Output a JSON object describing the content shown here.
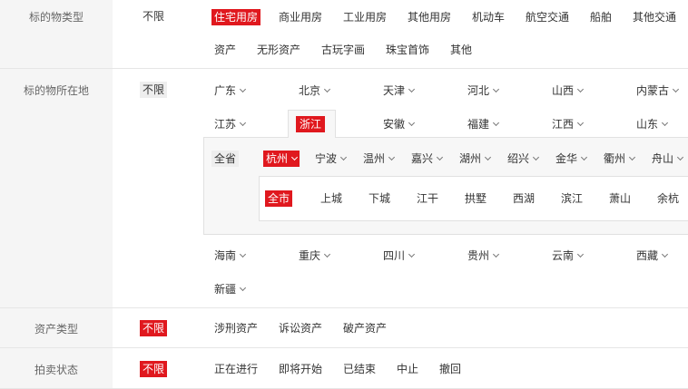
{
  "asset_type_row": {
    "label": "标的物类型",
    "no_limit": "不限",
    "items": [
      "住宅用房",
      "商业用房",
      "工业用房",
      "其他用房",
      "机动车",
      "航空交通",
      "船舶",
      "其他交通",
      "资产",
      "无形资产",
      "古玩字画",
      "珠宝首饰",
      "其他"
    ],
    "selected": "住宅用房"
  },
  "location_row": {
    "label": "标的物所在地",
    "no_limit": "不限",
    "provinces_top": [
      "广东",
      "北京",
      "天津",
      "河北",
      "山西",
      "内蒙古",
      "江苏",
      "浙江",
      "安徽",
      "福建",
      "江西",
      "山东"
    ],
    "selected_province": "浙江",
    "province_scope": "全省",
    "cities": [
      "杭州",
      "宁波",
      "温州",
      "嘉兴",
      "湖州",
      "绍兴",
      "金华",
      "衢州",
      "舟山"
    ],
    "selected_city": "杭州",
    "district_scope": "全市",
    "districts": [
      "上城",
      "下城",
      "江干",
      "拱墅",
      "西湖",
      "滨江",
      "萧山",
      "余杭"
    ],
    "provinces_bottom": [
      "海南",
      "重庆",
      "四川",
      "贵州",
      "云南",
      "西藏",
      "新疆"
    ]
  },
  "property_category_row": {
    "label": "资产类型",
    "no_limit": "不限",
    "items": [
      "涉刑资产",
      "诉讼资产",
      "破产资产"
    ]
  },
  "auction_status_row": {
    "label": "拍卖状态",
    "no_limit": "不限",
    "items": [
      "正在进行",
      "即将开始",
      "已结束",
      "中止",
      "撤回"
    ]
  },
  "colors": {
    "accent": "#e0181e",
    "label_bg": "#f5f5f5",
    "border": "#e6e6e6"
  }
}
